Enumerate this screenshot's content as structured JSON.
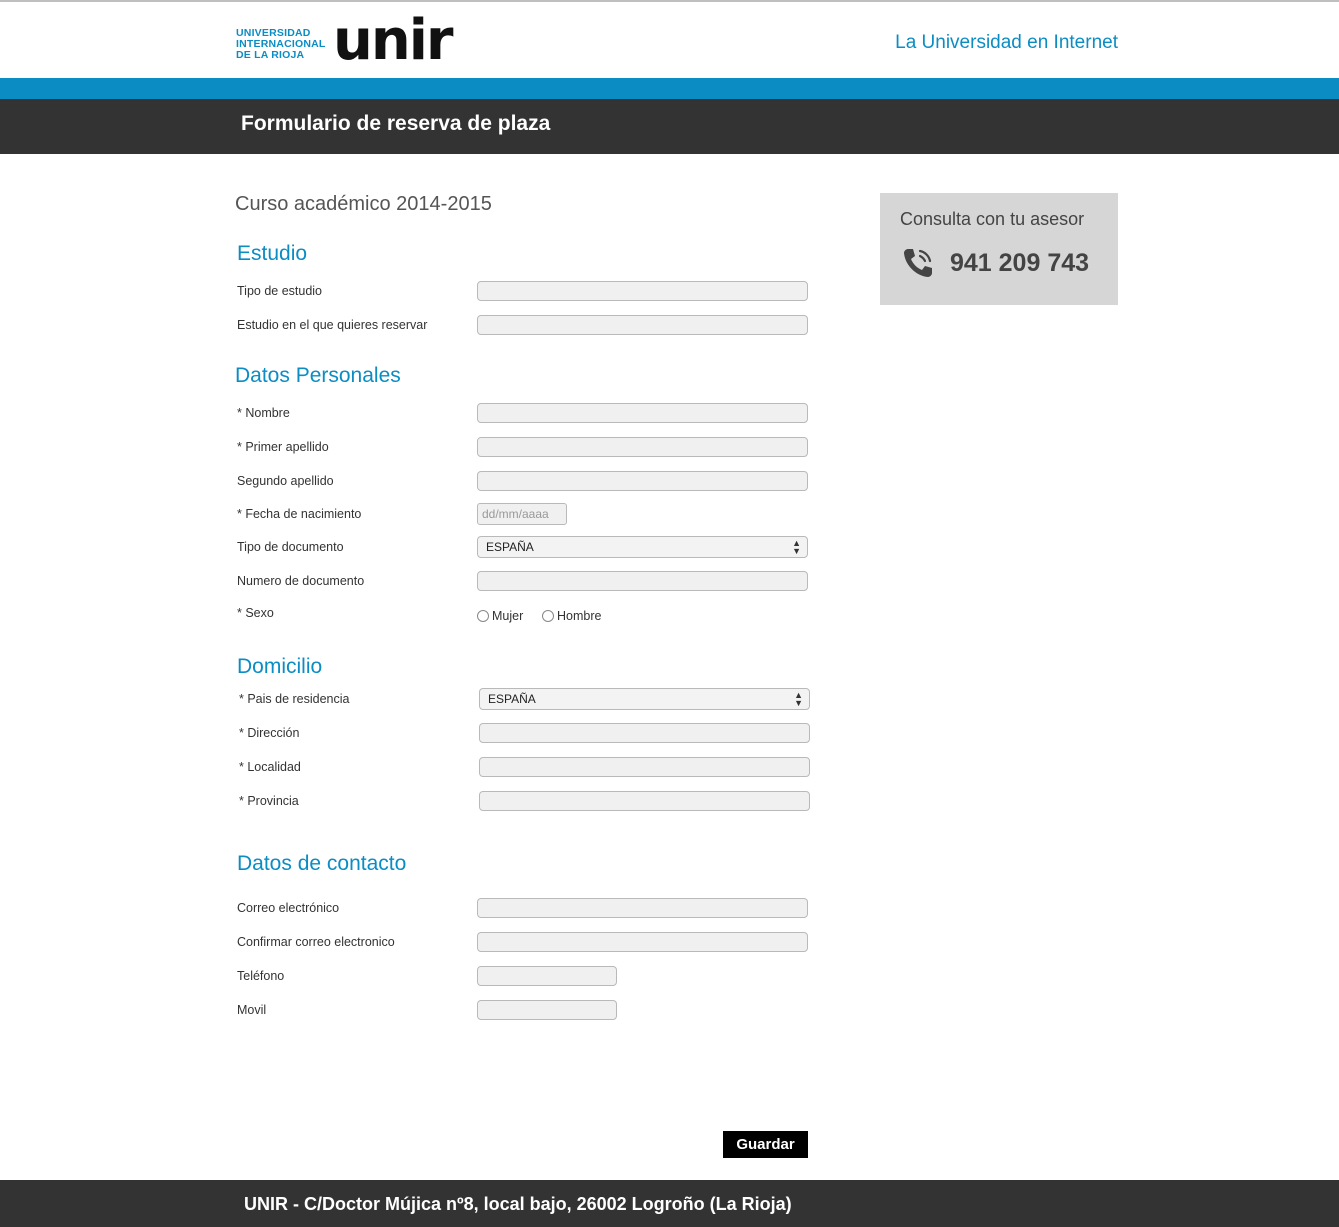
{
  "header": {
    "logo_small": [
      "UNIVERSIDAD",
      "INTERNACIONAL",
      "DE LA RIOJA"
    ],
    "logo_text": "unir",
    "tagline": "La Universidad en Internet"
  },
  "page_title": "Formulario de reserva de plaza",
  "course": "Curso académico 2014-2015",
  "sections": {
    "estudio": {
      "title": "Estudio",
      "fields": [
        "Tipo de estudio",
        "Estudio en el que quieres reservar"
      ]
    },
    "personales": {
      "title": "Datos Personales",
      "fields": [
        "* Nombre",
        "* Primer apellido",
        "Segundo apellido",
        "* Fecha de nacimiento",
        "Tipo de documento",
        "Numero de documento",
        "* Sexo"
      ],
      "date_placeholder": "dd/mm/aaaa",
      "doc_type_value": "ESPAÑA",
      "sex_options": [
        "Mujer",
        "Hombre"
      ]
    },
    "domicilio": {
      "title": "Domicilio",
      "fields": [
        "* Pais de residencia",
        "* Dirección",
        "* Localidad",
        "* Provincia"
      ],
      "country_value": "ESPAÑA"
    },
    "contacto": {
      "title": "Datos de contacto",
      "fields": [
        "Correo electrónico",
        "Confirmar correo electronico",
        "Teléfono",
        "Movil"
      ]
    }
  },
  "aside": {
    "cta": "Consulta con tu asesor",
    "phone": "941 209 743",
    "icon": "phone-icon"
  },
  "save_label": "Guardar",
  "footer": "UNIR - C/Doctor Mújica nº8, local bajo, 26002 Logroño (La Rioja)"
}
